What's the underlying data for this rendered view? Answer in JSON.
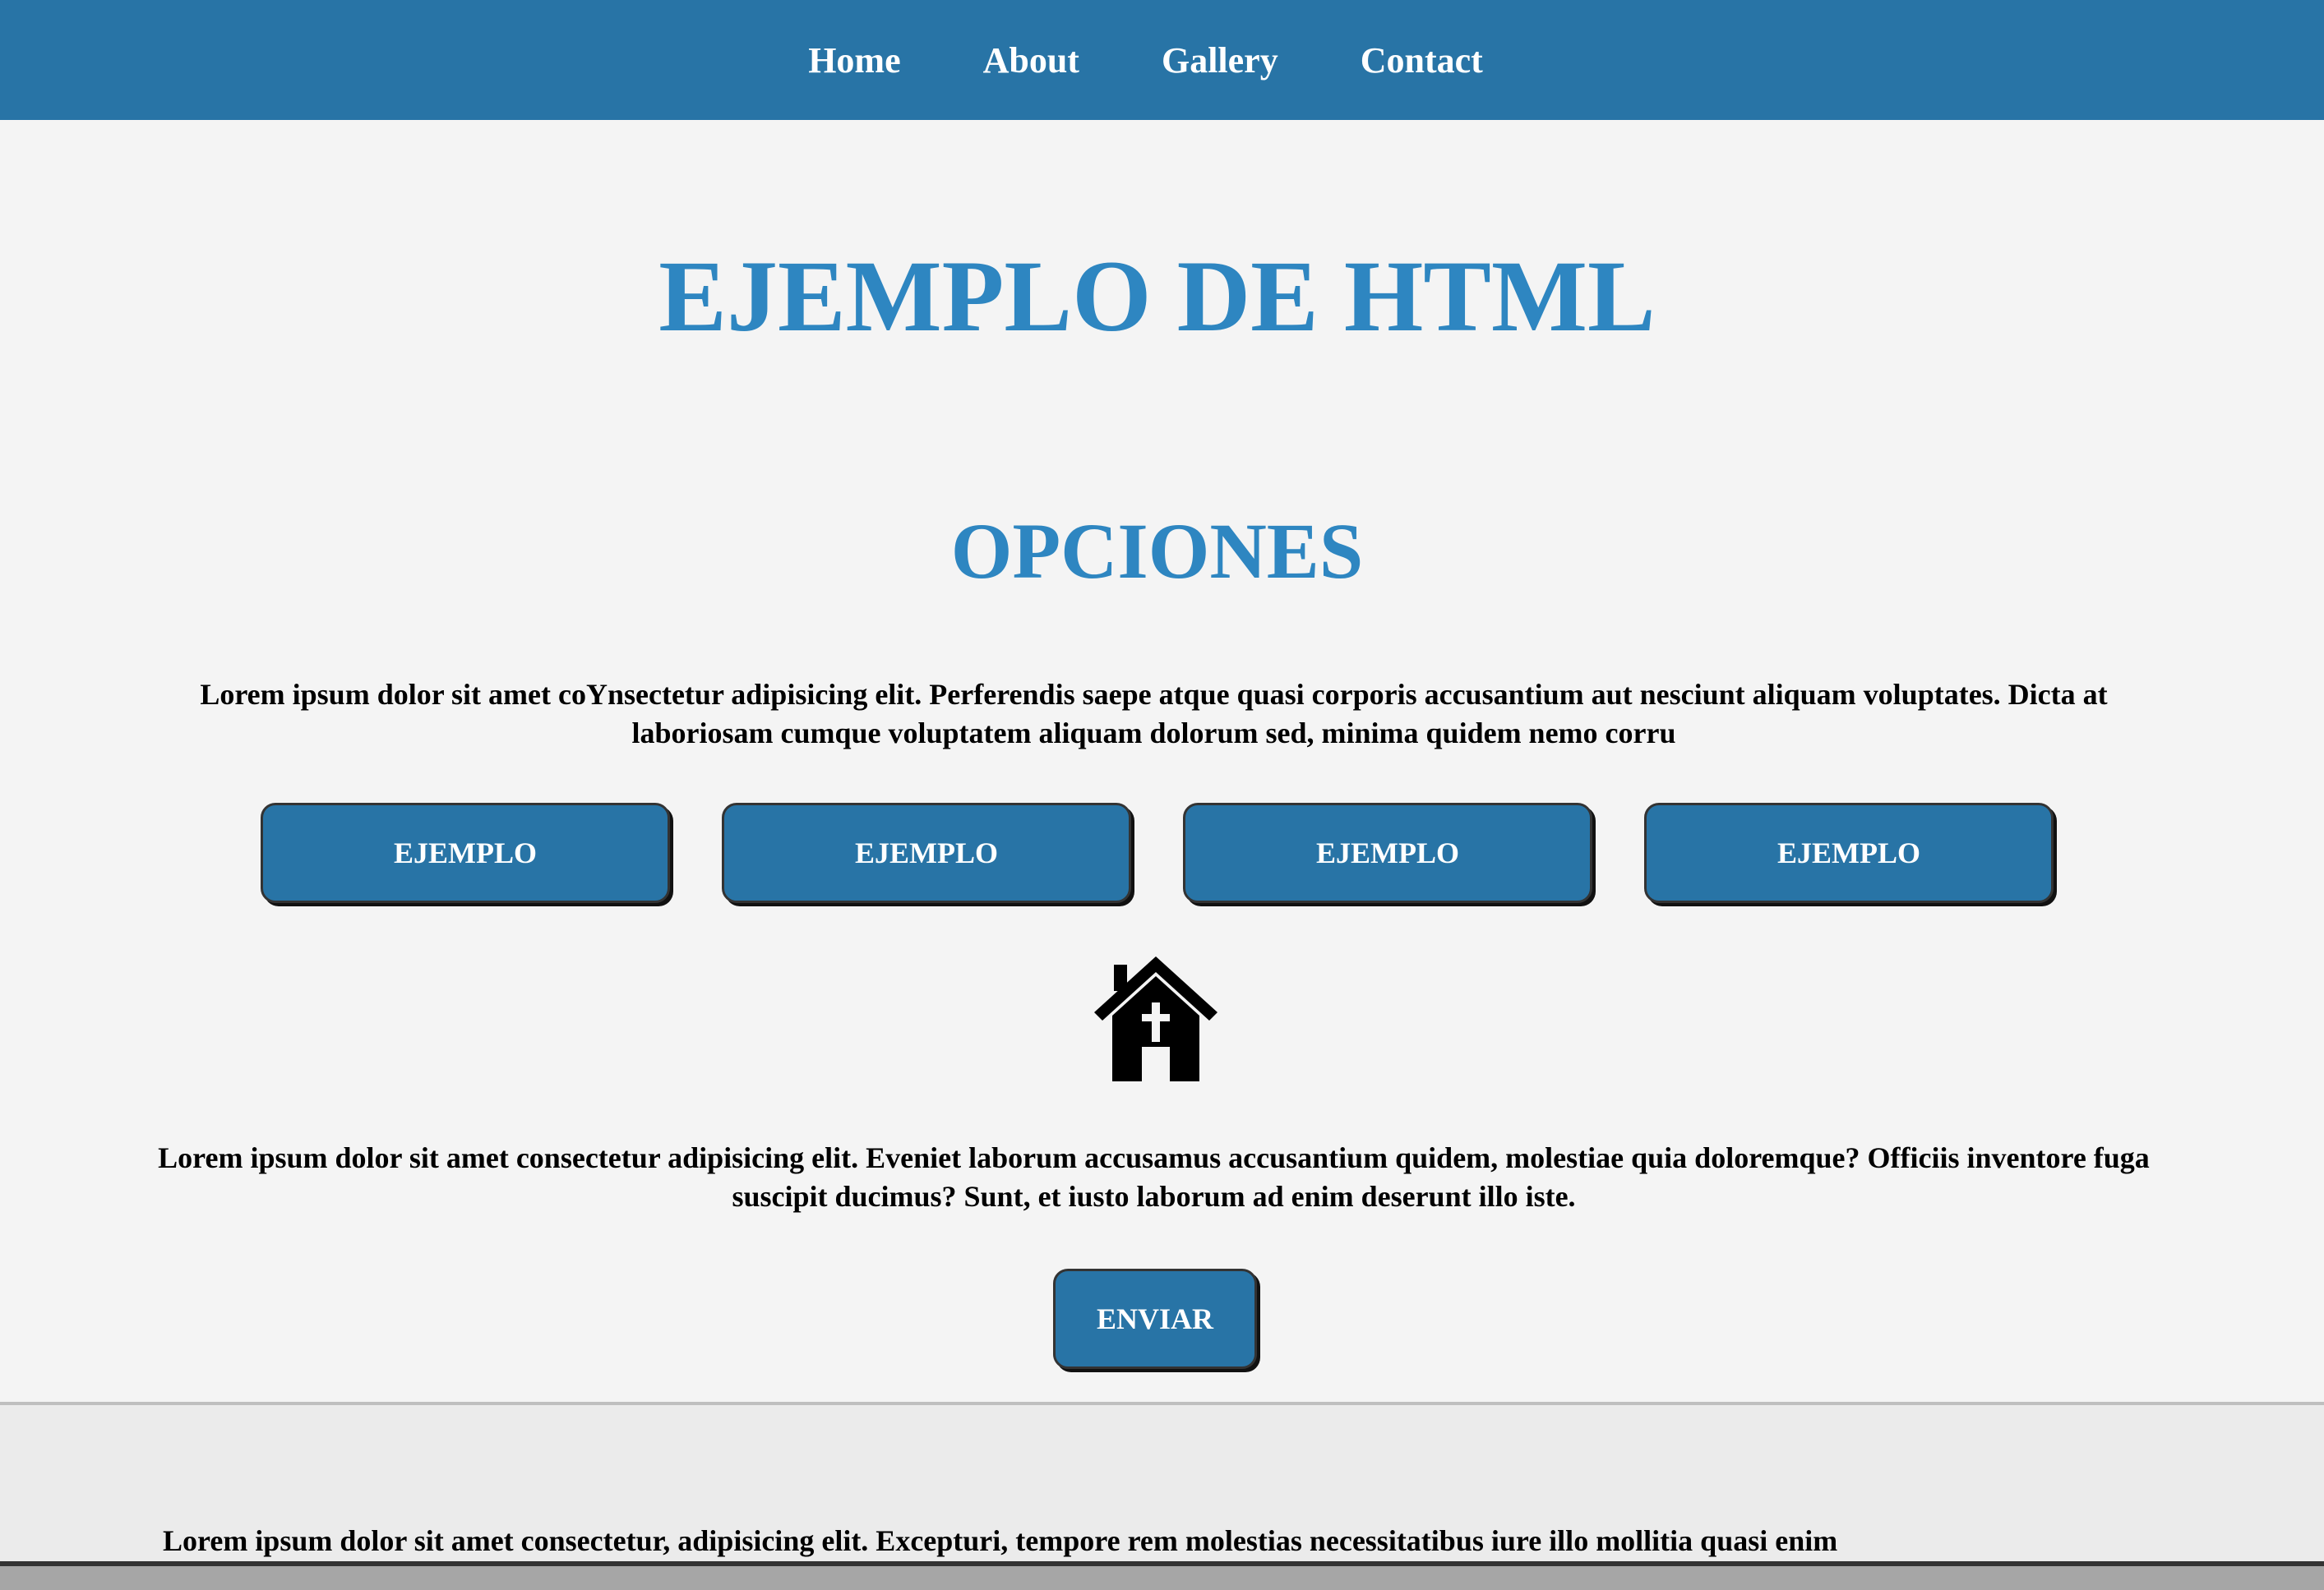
{
  "nav": {
    "items": [
      {
        "label": "Home"
      },
      {
        "label": "About"
      },
      {
        "label": "Gallery"
      },
      {
        "label": "Contact"
      }
    ]
  },
  "main": {
    "title": "EJEMPLO DE HTML",
    "subtitle": "OPCIONES",
    "paragraph_1": "Lorem ipsum dolor sit amet coYnsectetur adipisicing elit. Perferendis saepe atque quasi corporis accusantium aut nesciunt aliquam voluptates. Dicta at laboriosam cumque voluptatem aliquam dolorum sed, minima quidem nemo corru",
    "buttons": [
      {
        "label": "EJEMPLO"
      },
      {
        "label": "EJEMPLO"
      },
      {
        "label": "EJEMPLO"
      },
      {
        "label": "EJEMPLO"
      }
    ],
    "icon": "church-house-icon",
    "paragraph_2": "Lorem ipsum dolor sit amet consectetur adipisicing elit. Eveniet laborum accusamus accusantium quidem, molestiae quia doloremque? Officiis inventore fuga suscipit ducimus? Sunt, et iusto laborum ad enim deserunt illo iste.",
    "send_label": "ENVIAR"
  },
  "footer": {
    "text": "Lorem ipsum dolor sit amet consectetur, adipisicing elit. Excepturi, tempore rem molestias necessitatibus iure illo mollitia quasi enim"
  },
  "colors": {
    "nav_bg": "#2874a6",
    "heading": "#2e86c1",
    "button_bg": "#2874a6",
    "page_bg": "#f4f4f4",
    "footer_bg": "#ebebeb"
  }
}
